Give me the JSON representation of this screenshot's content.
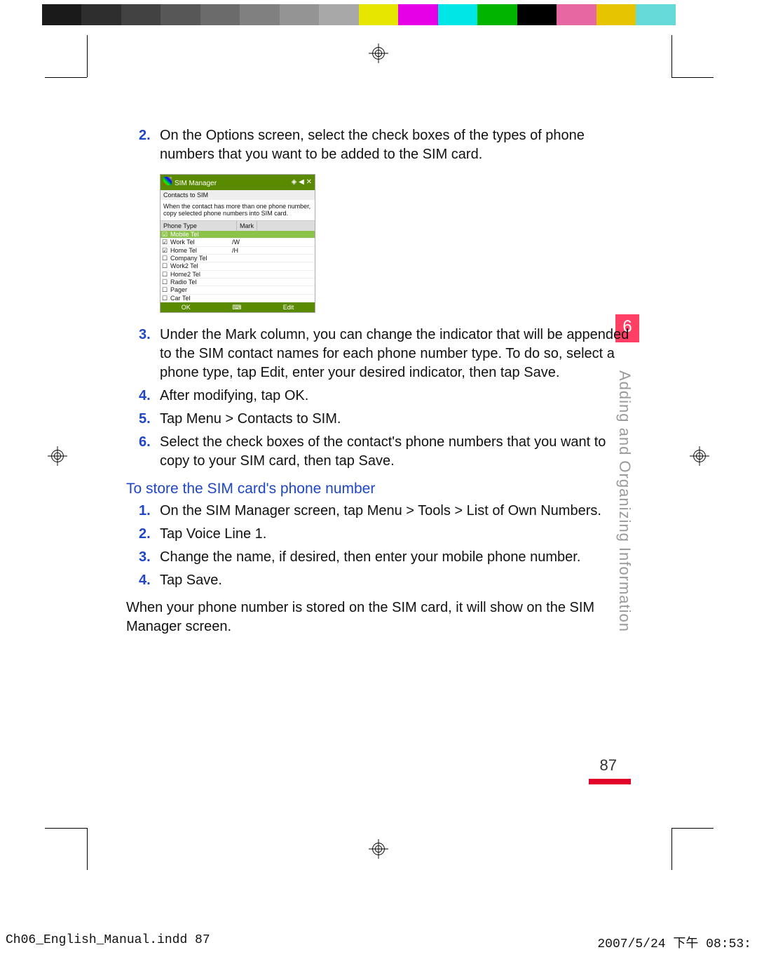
{
  "colorbar": [
    "#1a1a1a",
    "#2e2e2e",
    "#424242",
    "#575757",
    "#6b6b6b",
    "#808080",
    "#949494",
    "#a8a8a8",
    "#e6e600",
    "#e600e6",
    "#00e6e6",
    "#00b400",
    "#000000",
    "#e668a3",
    "#e6c400",
    "#66d9d9",
    "#ffffff"
  ],
  "stepsA": [
    {
      "n": "2.",
      "text": "On the Options screen, select the check boxes of the types of phone numbers that you want to be added to the SIM card."
    },
    {
      "n": "3.",
      "text": "Under the Mark column, you can change the indicator that will be appended to the SIM contact names for each phone number type. To do so, select a phone type, tap Edit, enter your desired indicator, then tap Save."
    },
    {
      "n": "4.",
      "text": "After modifying, tap OK."
    },
    {
      "n": "5.",
      "text": "Tap Menu > Contacts to SIM."
    },
    {
      "n": "6.",
      "text": "Select the check boxes of the contact's phone numbers that you want to copy to your SIM card, then tap Save."
    }
  ],
  "screenshot": {
    "title": "SIM Manager",
    "status_icons": "◈ ◀ ✕",
    "subtitle": "Contacts to SIM",
    "desc": "When the contact has more than one phone number, copy selected phone numbers into SIM card.",
    "col1": "Phone Type",
    "col2": "Mark",
    "rows": [
      {
        "checked": true,
        "label": "Mobile Tel",
        "mark": "",
        "sel": true
      },
      {
        "checked": true,
        "label": "Work Tel",
        "mark": "/W"
      },
      {
        "checked": true,
        "label": "Home Tel",
        "mark": "/H"
      },
      {
        "checked": false,
        "label": "Company Tel",
        "mark": ""
      },
      {
        "checked": false,
        "label": "Work2 Tel",
        "mark": ""
      },
      {
        "checked": false,
        "label": "Home2 Tel",
        "mark": ""
      },
      {
        "checked": false,
        "label": "Radio Tel",
        "mark": ""
      },
      {
        "checked": false,
        "label": "Pager",
        "mark": ""
      },
      {
        "checked": false,
        "label": "Car Tel",
        "mark": ""
      }
    ],
    "bottom_left": "OK",
    "bottom_mid": "⌨",
    "bottom_right": "Edit"
  },
  "heading2": "To store the SIM card's phone number",
  "stepsB": [
    {
      "n": "1.",
      "text": "On the SIM Manager screen, tap Menu > Tools > List of Own Numbers."
    },
    {
      "n": "2.",
      "text": "Tap Voice Line 1."
    },
    {
      "n": "3.",
      "text": "Change the name, if desired, then enter your mobile phone number."
    },
    {
      "n": "4.",
      "text": "Tap Save."
    }
  ],
  "para_after": "When your phone number is stored on the SIM card, it will show on the SIM Manager screen.",
  "chapter_num": "6",
  "chapter_title": "Adding and Organizing Information",
  "page_number": "87",
  "footer_left": "Ch06_English_Manual.indd   87",
  "footer_right": "2007/5/24   下午 08:53:"
}
